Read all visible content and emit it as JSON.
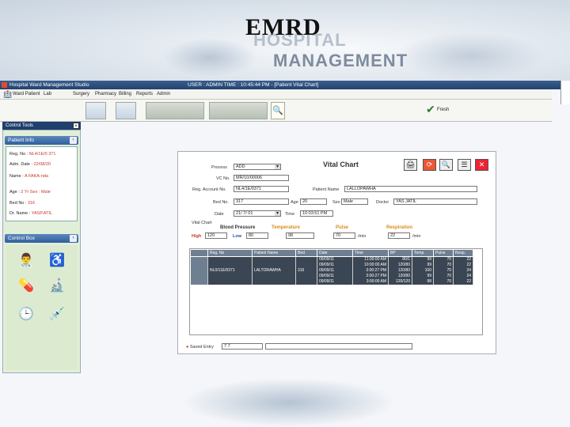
{
  "slide": {
    "title": "EMRD",
    "bg_line1": "HOSPITAL",
    "bg_line2": "MANAGEMENT"
  },
  "window": {
    "app_title": "Hospital Ward Management Studio",
    "status": "USER : ADMIN     TIME : 10:45:44 PM - [Patient Vital Chart]"
  },
  "menu": [
    "Ward Patient",
    "Lab",
    "Surgery",
    "Pharmacy",
    "Billing",
    "Reports",
    "Admin"
  ],
  "toolbar": {
    "refresh_label": "Fresh"
  },
  "control_tools": {
    "title": "Control Tools",
    "patient_info_title": "Patient Info",
    "patient_rows": [
      {
        "label": "Reg. No : ",
        "value": "NL4/1E/0 371"
      },
      {
        "label": "Adm. Date : ",
        "value": "22/08/20"
      },
      {
        "label": "Name : ",
        "value": "A FAKA-nda"
      },
      {
        "label": "Age : ",
        "value": "2 Yr    Sex : Male"
      },
      {
        "label": "Bed No : ",
        "value": "316"
      },
      {
        "label": "Dr. Name : ",
        "value": "YASP.ATIL"
      }
    ],
    "control_box_title": "Control Box",
    "icons": [
      "doctor-icon",
      "wheelchair-icon",
      "pills-icon",
      "microscope-icon",
      "clock-icon",
      "syringe-icon"
    ]
  },
  "vital_form": {
    "title": "Vital Chart",
    "process_label": "Process",
    "process_value": "ADD",
    "vc_no_label": "VC No.",
    "vc_no_value": "MR/10/00006",
    "reg_label": "Reg. Account No.",
    "reg_value": "NL4/1E/0371",
    "patient_name_label": "Patient Name",
    "patient_name_value": "LALLOPAWHA",
    "bed_label": "Bed No.",
    "bed_value": "317",
    "age_label": "Age",
    "age_value": "20",
    "sex_label": "Sex",
    "sex_value": "Male",
    "doctor_label": "Doctor",
    "doctor_value": "YAS JATIL",
    "date_label": "Date",
    "date_value": "21/ 7/ 01",
    "time_label": "Time",
    "time_value": "10:03:51 PM",
    "chart_label": "Vital Chart",
    "bp_title": "Blood Pressure",
    "temp_title": "Temperature",
    "pulse_title": "Pulse",
    "resp_title": "Respiration",
    "high_label": "High",
    "high_value": "120",
    "low_label": "Low",
    "low_value": "80",
    "temp_value": "98",
    "pulse_value": "70",
    "pulse_unit": "/min",
    "resp_value": "22",
    "resp_unit": "/min",
    "entry_label": "Saved Entry",
    "entry_value": "7 7"
  },
  "table": {
    "columns": [
      "Reg. No",
      "Patient Name",
      "Bed",
      "Date",
      "Time",
      "BP",
      "Temp.",
      "Pulse",
      "Resp."
    ],
    "reg_no": "NL0/11E/0371",
    "patient_name": "LALTORAWHA",
    "bed": "316",
    "rows": [
      {
        "date": "09/09/11",
        "time": "11:00:00 AM",
        "bp": "80/1",
        "temp": "99",
        "pulse": "70",
        "resp": "22"
      },
      {
        "date": "09/09/11",
        "time": "10:00:00 AM",
        "bp": "120/80",
        "temp": "99",
        "pulse": "70",
        "resp": "22"
      },
      {
        "date": "09/09/11",
        "time": "3:00:27 PM",
        "bp": "120/80",
        "temp": "100",
        "pulse": "70",
        "resp": "24"
      },
      {
        "date": "09/09/11",
        "time": "3:00:27 PM",
        "bp": "120/80",
        "temp": "99",
        "pulse": "70",
        "resp": "24"
      },
      {
        "date": "09/09/11",
        "time": "3:00:00 AM",
        "bp": "120/120",
        "temp": "98",
        "pulse": "70",
        "resp": "22"
      }
    ]
  }
}
